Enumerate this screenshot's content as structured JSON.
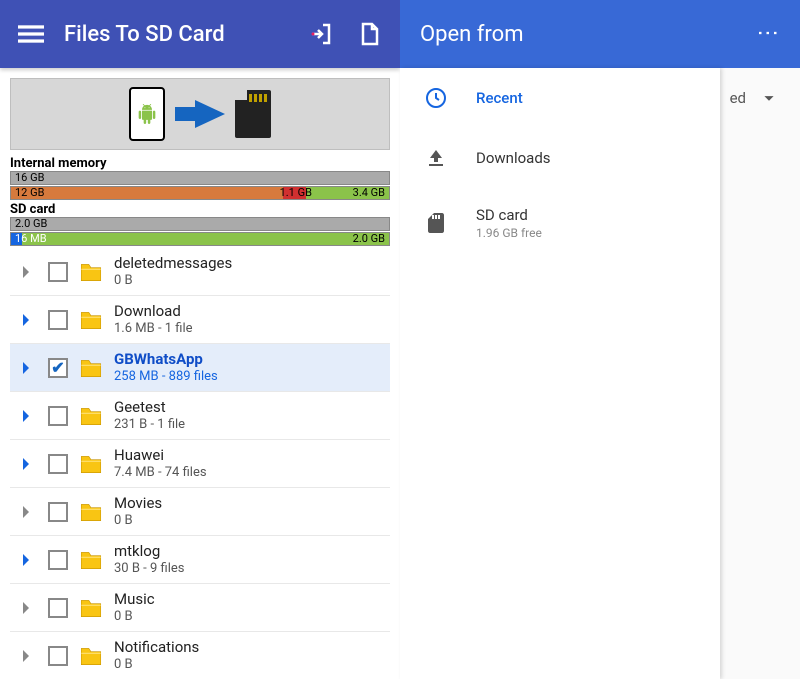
{
  "left": {
    "title": "Files To SD Card",
    "storage": {
      "internal": {
        "label": "Internal memory",
        "total": "16 GB",
        "used_row": {
          "used_label": "12 GB",
          "mid_label": "1.1 GB",
          "free_label": "3.4 GB"
        }
      },
      "sd": {
        "label": "SD card",
        "total": "2.0 GB",
        "used_label": "16 MB",
        "free_label": "2.0 GB"
      }
    },
    "files": [
      {
        "name": "deletedmessages",
        "sub": "0 B",
        "expandable": false,
        "checked": false,
        "selected": false
      },
      {
        "name": "Download",
        "sub": "1.6 MB - 1 file",
        "expandable": true,
        "checked": false,
        "selected": false
      },
      {
        "name": "GBWhatsApp",
        "sub": "258 MB - 889 files",
        "expandable": true,
        "checked": true,
        "selected": true
      },
      {
        "name": "Geetest",
        "sub": "231 B - 1 file",
        "expandable": true,
        "checked": false,
        "selected": false
      },
      {
        "name": "Huawei",
        "sub": "7.4 MB - 74 files",
        "expandable": true,
        "checked": false,
        "selected": false
      },
      {
        "name": "Movies",
        "sub": "0 B",
        "expandable": false,
        "checked": false,
        "selected": false
      },
      {
        "name": "mtklog",
        "sub": "30 B - 9 files",
        "expandable": true,
        "checked": false,
        "selected": false
      },
      {
        "name": "Music",
        "sub": "0 B",
        "expandable": false,
        "checked": false,
        "selected": false
      },
      {
        "name": "Notifications",
        "sub": "0 B",
        "expandable": false,
        "checked": false,
        "selected": false
      }
    ]
  },
  "right": {
    "title": "Open from",
    "items": [
      {
        "icon": "clock",
        "title": "Recent",
        "sub": "",
        "active": true
      },
      {
        "icon": "download",
        "title": "Downloads",
        "sub": "",
        "active": false
      },
      {
        "icon": "sdcard",
        "title": "SD card",
        "sub": "1.96 GB free",
        "active": false
      }
    ],
    "underlay_label": "ed"
  }
}
